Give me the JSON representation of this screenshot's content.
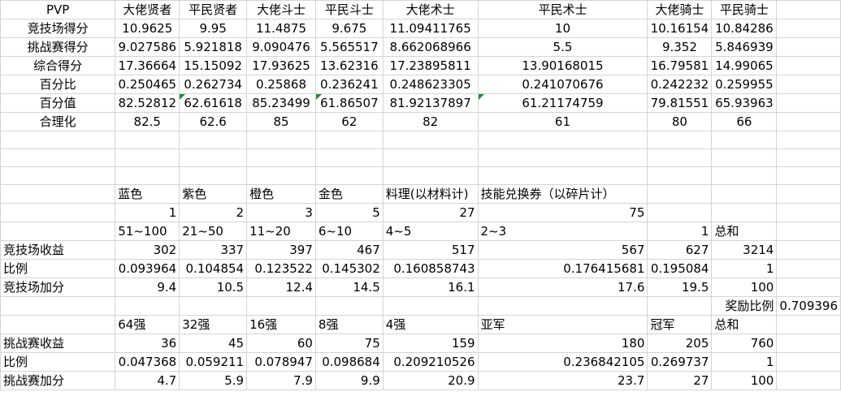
{
  "sheet": {
    "pvp_table": {
      "header": [
        "PVP",
        "大佬贤者",
        "平民贤者",
        "大佬斗士",
        "平民斗士",
        "大佬术士",
        "平民术士",
        "大佬骑士",
        "平民骑士"
      ],
      "rows": [
        {
          "label": "竞技场得分",
          "values": [
            "10.9625",
            "9.95",
            "11.4875",
            "9.675",
            "11.09411765",
            "10",
            "10.16154",
            "10.84286"
          ]
        },
        {
          "label": "挑战赛得分",
          "values": [
            "9.027586",
            "5.921818",
            "9.090476",
            "5.565517",
            "8.662068966",
            "5.5",
            "9.352",
            "5.846939"
          ]
        },
        {
          "label": "综合得分",
          "values": [
            "17.36664",
            "15.15092",
            "17.93625",
            "13.62316",
            "17.23895811",
            "13.90168015",
            "16.79581",
            "14.99065"
          ]
        },
        {
          "label": "百分比",
          "values": [
            "0.250465",
            "0.262734",
            "0.25868",
            "0.236241",
            "0.248623305",
            "0.241070676",
            "0.242232",
            "0.259955"
          ]
        },
        {
          "label": "百分值",
          "values": [
            "82.52812",
            "62.61618",
            "85.23499",
            "61.86507",
            "81.92137897",
            "61.21174759",
            "79.81551",
            "65.93963"
          ]
        },
        {
          "label": "合理化",
          "values": [
            "82.5",
            "62.6",
            "85",
            "62",
            "82",
            "61",
            "80",
            "66"
          ]
        }
      ]
    },
    "arena_table": {
      "header": [
        "蓝色",
        "紫色",
        "橙色",
        "金色",
        "料理(以材料计)",
        "技能兑换券（以碎片计）"
      ],
      "units": [
        "1",
        "2",
        "3",
        "5",
        "27",
        "75"
      ],
      "ranges": [
        "51~100",
        "21~50",
        "11~20",
        "6~10",
        "4~5",
        "2~3",
        "",
        ""
      ],
      "one_value": "1",
      "total_label": "总和",
      "income": {
        "label": "竞技场收益",
        "values": [
          "302",
          "337",
          "397",
          "467",
          "517",
          "567",
          "627",
          "3214"
        ]
      },
      "ratio": {
        "label": "比例",
        "values": [
          "0.093964",
          "0.104854",
          "0.123522",
          "0.145302",
          "0.160858743",
          "0.176415681",
          "0.195084",
          "1"
        ]
      },
      "bonus": {
        "label": "竞技场加分",
        "values": [
          "9.4",
          "10.5",
          "12.4",
          "14.5",
          "16.1",
          "17.6",
          "19.5",
          "100"
        ]
      }
    },
    "reward_ratio": {
      "label": "奖励比例",
      "value": "0.709396"
    },
    "challenge_table": {
      "header": [
        "64强",
        "32强",
        "16强",
        "8强",
        "4强",
        "亚军",
        "",
        "冠军",
        "总和"
      ],
      "income": {
        "label": "挑战赛收益",
        "values": [
          "36",
          "45",
          "60",
          "75",
          "159",
          "180",
          "205",
          "760"
        ]
      },
      "ratio": {
        "label": "比例",
        "values": [
          "0.047368",
          "0.059211",
          "0.078947",
          "0.098684",
          "0.209210526",
          "0.236842105",
          "0.269737",
          "1"
        ]
      },
      "bonus": {
        "label": "挑战赛加分",
        "values": [
          "4.7",
          "5.9",
          "7.9",
          "9.9",
          "20.9",
          "23.7",
          "27",
          "100"
        ]
      }
    }
  }
}
